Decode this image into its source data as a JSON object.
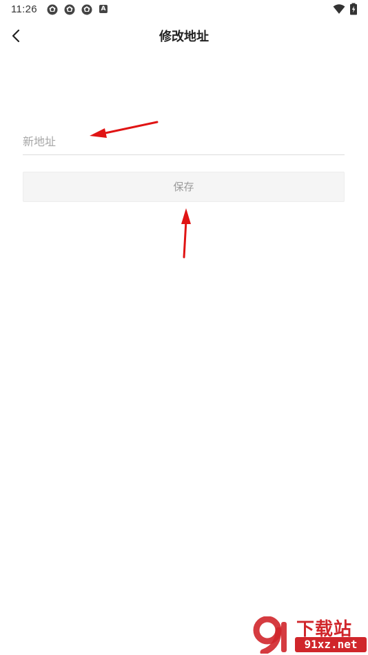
{
  "status_bar": {
    "time": "11:26",
    "icons": [
      "aperture-icon",
      "aperture-icon",
      "aperture-icon",
      "a-badge-icon",
      "wifi-icon",
      "battery-icon"
    ],
    "badge_letter": "A"
  },
  "header": {
    "title": "修改地址",
    "back_icon": "chevron-left-icon"
  },
  "form": {
    "address_placeholder": "新地址",
    "address_value": "",
    "save_label": "保存"
  },
  "annotations": {
    "arrow_color": "#e01414"
  },
  "watermark": {
    "logo_text": "9",
    "top_text": "下载站",
    "bottom_text": "91xz.net",
    "color": "#d0262b"
  }
}
